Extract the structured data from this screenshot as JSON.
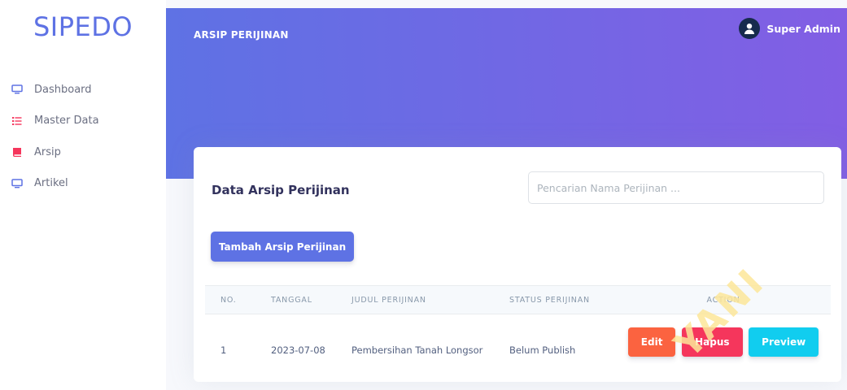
{
  "brand": "SIPEDO",
  "sidebar": {
    "items": [
      {
        "label": "Dashboard",
        "icon": "monitor-icon",
        "color": "#5e72e4"
      },
      {
        "label": "Master Data",
        "icon": "list-icon",
        "color": "#f5365c"
      },
      {
        "label": "Arsip",
        "icon": "book-icon",
        "color": "#f5365c"
      },
      {
        "label": "Artikel",
        "icon": "monitor-icon",
        "color": "#5e72e4"
      }
    ]
  },
  "header": {
    "title": "ARSIP PERIJINAN",
    "user_name": "Super Admin"
  },
  "card": {
    "title": "Data Arsip Perijinan",
    "search_placeholder": "Pencarian Nama Perijinan ...",
    "add_button": "Tambah Arsip Perijinan"
  },
  "table": {
    "columns": [
      "NO.",
      "TANGGAL",
      "JUDUL PERIJINAN",
      "STATUS PERIJINAN",
      "ACTION"
    ],
    "rows": [
      {
        "no": "1",
        "tanggal": "2023-07-08",
        "judul": "Pembersihan Tanah Longsor",
        "status": "Belum Publish"
      }
    ],
    "actions": {
      "edit": "Edit",
      "hapus": "Hapus",
      "preview": "Preview"
    }
  },
  "watermark": "YANI",
  "colors": {
    "primary": "#5e72e4",
    "gradient_end": "#825ee4",
    "warning": "#fb6340",
    "danger": "#f5365c",
    "info": "#11cdef"
  }
}
